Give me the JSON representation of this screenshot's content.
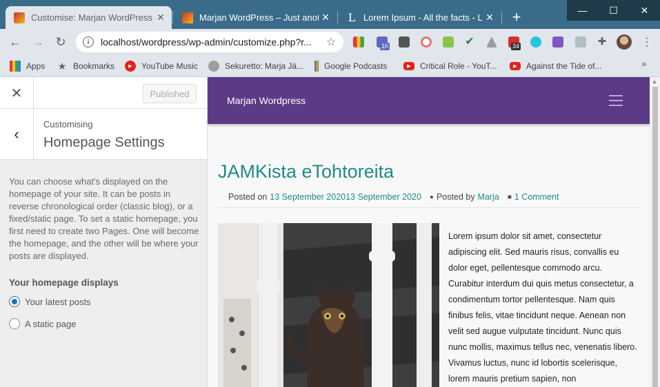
{
  "browser": {
    "tabs": [
      {
        "title": "Customise: Marjan WordPress – Just",
        "active": true
      },
      {
        "title": "Marjan WordPress – Just another",
        "active": false
      },
      {
        "title": "Lorem Ipsum - All the facts - Lipsum",
        "active": false
      }
    ],
    "tab3_favicon_letter": "L",
    "address": "localhost/wordpress/wp-admin/customize.php?r...",
    "extension_badges": {
      "counter": "34",
      "tab": "1h"
    },
    "bookmarks": [
      {
        "label": "Apps",
        "icon": "apps-grid-icon"
      },
      {
        "label": "Bookmarks",
        "icon": "star-icon"
      },
      {
        "label": "YouTube Music",
        "icon": "youtube-music-icon"
      },
      {
        "label": "Sekuretto: Marja Jä...",
        "icon": "globe-icon"
      },
      {
        "label": "Google Podcasts",
        "icon": "podcasts-icon"
      },
      {
        "label": "Critical Role - YouT...",
        "icon": "youtube-icon"
      },
      {
        "label": "Against the Tide of...",
        "icon": "youtube-icon"
      }
    ]
  },
  "sidebar": {
    "publish_label": "Published",
    "breadcrumb": "Customising",
    "section_title": "Homepage Settings",
    "description": "You can choose what's displayed on the homepage of your site. It can be posts in reverse chronological order (classic blog), or a fixed/static page. To set a static homepage, you first need to create two Pages. One will become the homepage, and the other will be where your posts are displayed.",
    "homepage_label": "Your homepage displays",
    "options": [
      {
        "label": "Your latest posts",
        "checked": true
      },
      {
        "label": "A static page",
        "checked": false
      }
    ]
  },
  "preview": {
    "site_title": "Marjan Wordpress",
    "post_title": "JAMKista eTohtoreita",
    "meta": {
      "posted_on_label": "Posted on",
      "date": "13 September 202013 September 2020",
      "posted_by_label": "Posted by",
      "author": "Marja",
      "comments": "1 Comment"
    },
    "post_text": "Lorem ipsum dolor sit amet, consectetur adipiscing elit. Sed mauris risus, convallis eu dolor eget, pellentesque commodo arcu. Curabitur interdum dui quis metus consectetur, a condimentum tortor pellentesque. Nam quis finibus felis, vitae tincidunt neque. Aenean non velit sed augue vulputate tincidunt. Nunc quis nunc mollis, maximus tellus nec, venenatis libero. Vivamus luctus, nunc id lobortis scelerisque, lorem mauris pretium sapien, non"
  },
  "colors": {
    "tabstrip": "#3a6c89",
    "site_header": "#5b3a86",
    "link_teal": "#1f8a8a",
    "radio_accent": "#2271b1"
  }
}
